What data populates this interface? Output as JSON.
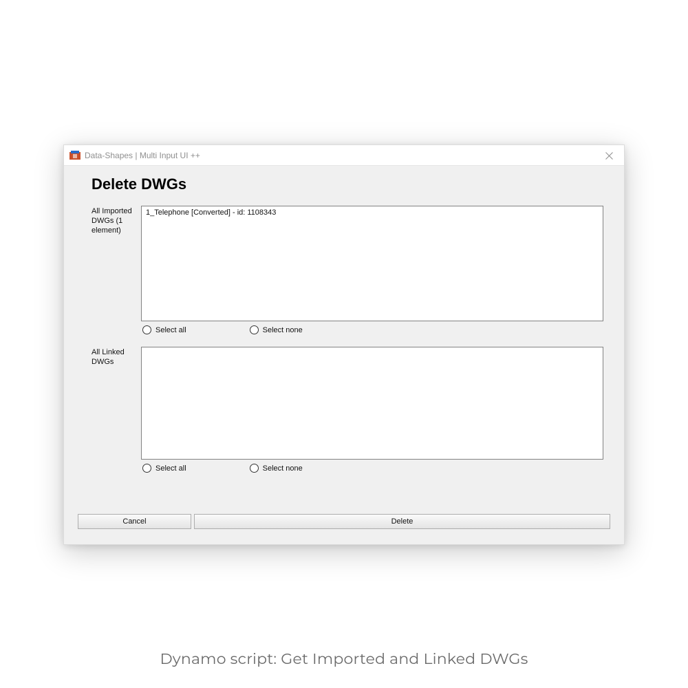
{
  "titlebar": {
    "title": "Data-Shapes | Multi Input UI ++"
  },
  "dialog": {
    "heading": "Delete DWGs",
    "groups": {
      "imported": {
        "label_line1": "All Imported DWGs",
        "label_line2": "(1 element)",
        "items": [
          "1_Telephone [Converted]  - id: 1108343"
        ],
        "select_all": "Select all",
        "select_none": "Select none"
      },
      "linked": {
        "label": "All Linked DWGs",
        "items": [],
        "select_all": "Select all",
        "select_none": "Select none"
      }
    },
    "buttons": {
      "cancel": "Cancel",
      "delete": "Delete"
    }
  },
  "caption": "Dynamo script: Get Imported and Linked DWGs"
}
